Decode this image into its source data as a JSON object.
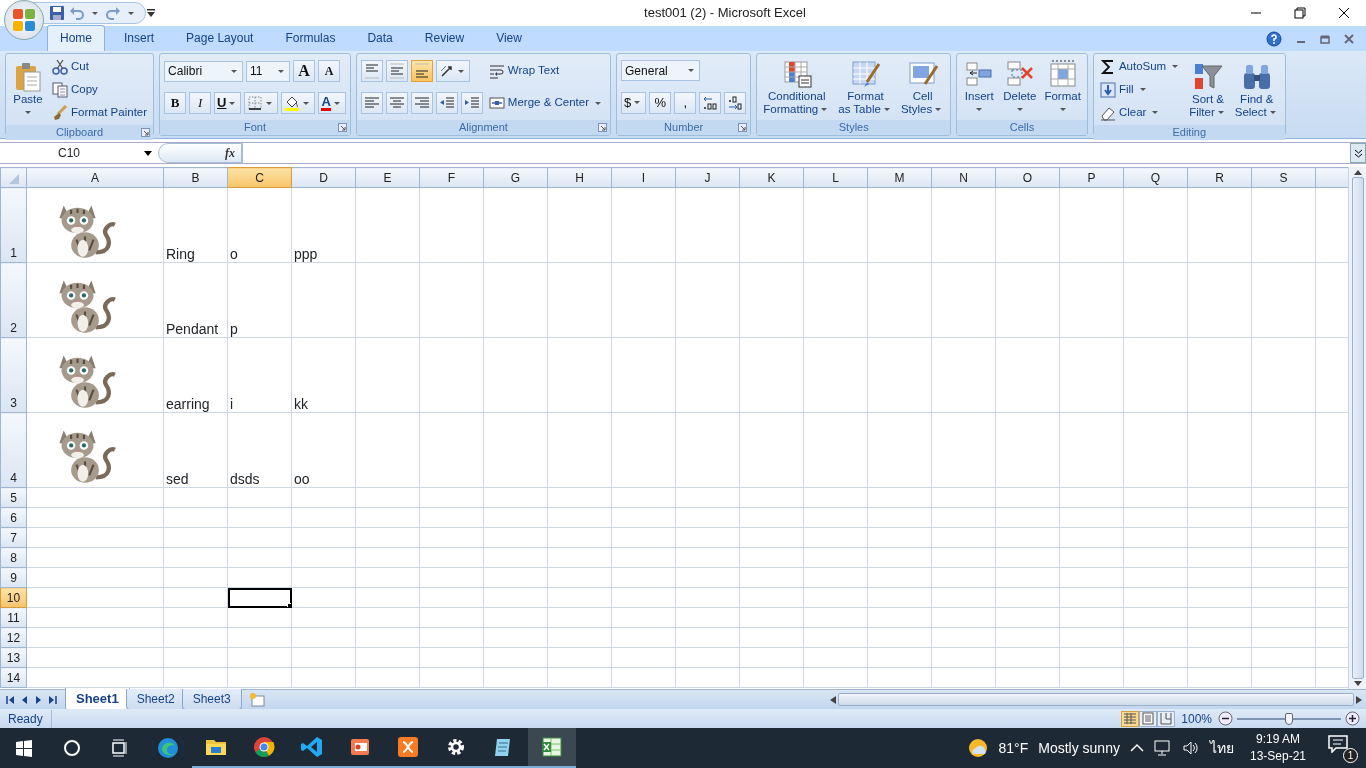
{
  "window": {
    "title": "test001 (2) - Microsoft Excel"
  },
  "tabs": [
    {
      "label": "Home",
      "selected": true
    },
    {
      "label": "Insert",
      "selected": false
    },
    {
      "label": "Page Layout",
      "selected": false
    },
    {
      "label": "Formulas",
      "selected": false
    },
    {
      "label": "Data",
      "selected": false
    },
    {
      "label": "Review",
      "selected": false
    },
    {
      "label": "View",
      "selected": false
    }
  ],
  "ribbon": [
    {
      "label": "Clipboard",
      "launcher": true,
      "columns": [
        [
          {
            "kind": "large",
            "lines": [
              "Paste"
            ],
            "menu": true
          }
        ],
        [
          {
            "kind": "small",
            "label": "Cut"
          },
          {
            "kind": "small",
            "label": "Copy"
          },
          {
            "kind": "small",
            "label": "Format Painter"
          }
        ]
      ]
    },
    {
      "label": "Font",
      "launcher": true,
      "columns": [
        [
          {
            "kind": "row",
            "items": [
              {
                "kind": "combo",
                "value": "Calibri"
              },
              {
                "kind": "combo",
                "value": "11"
              },
              {
                "kind": "tool",
                "glyph": "A",
                "on": false
              },
              {
                "kind": "tool",
                "glyph": "A",
                "on": false
              }
            ]
          },
          {
            "kind": "row",
            "items": [
              {
                "kind": "tool",
                "glyph": "B",
                "on": false
              },
              {
                "kind": "tool",
                "glyph": "I",
                "on": false
              },
              {
                "kind": "tool",
                "glyph": "U",
                "on": false,
                "menu": true
              },
              {
                "kind": "tool",
                "on": false,
                "menu": true
              },
              {
                "kind": "tool",
                "on": false,
                "menu": true
              },
              {
                "kind": "tool",
                "glyph": "A",
                "on": false,
                "menu": true
              }
            ]
          }
        ]
      ]
    },
    {
      "label": "Alignment",
      "launcher": true,
      "columns": [
        [
          {
            "kind": "row",
            "items": [
              {
                "kind": "tool",
                "on": false
              },
              {
                "kind": "tool",
                "on": false
              },
              {
                "kind": "tool",
                "on": true
              },
              {
                "kind": "tool",
                "on": false,
                "menu": true
              }
            ]
          },
          {
            "kind": "row",
            "items": [
              {
                "kind": "tool",
                "on": false
              },
              {
                "kind": "tool",
                "on": false
              },
              {
                "kind": "tool",
                "on": false
              },
              {
                "kind": "tool",
                "on": false
              },
              {
                "kind": "tool",
                "on": false
              }
            ]
          }
        ],
        [
          {
            "kind": "small",
            "label": "Wrap Text"
          },
          {
            "kind": "small",
            "label": "Merge & Center",
            "menu": true
          }
        ]
      ]
    },
    {
      "label": "Number",
      "launcher": true,
      "columns": [
        [
          {
            "kind": "row",
            "items": [
              {
                "kind": "combo",
                "value": "General"
              }
            ]
          },
          {
            "kind": "row",
            "items": [
              {
                "kind": "tool",
                "glyph": "$",
                "on": false,
                "menu": true
              },
              {
                "kind": "tool",
                "glyph": "%",
                "on": false
              },
              {
                "kind": "tool",
                "glyph": ",",
                "on": false
              },
              {
                "kind": "tool",
                "on": false
              },
              {
                "kind": "tool",
                "on": false
              }
            ]
          }
        ]
      ]
    },
    {
      "label": "Styles",
      "columns": [
        [
          {
            "kind": "large",
            "lines": [
              "Conditional",
              "Formatting"
            ],
            "menu": true
          }
        ],
        [
          {
            "kind": "large",
            "lines": [
              "Format",
              "as Table"
            ],
            "menu": true
          }
        ],
        [
          {
            "kind": "large",
            "lines": [
              "Cell",
              "Styles"
            ],
            "menu": true
          }
        ]
      ]
    },
    {
      "label": "Cells",
      "columns": [
        [
          {
            "kind": "large",
            "lines": [
              "Insert"
            ],
            "menu": true
          }
        ],
        [
          {
            "kind": "large",
            "lines": [
              "Delete"
            ],
            "menu": true
          }
        ],
        [
          {
            "kind": "large",
            "lines": [
              "Format"
            ],
            "menu": true
          }
        ]
      ]
    },
    {
      "label": "Editing",
      "columns": [
        [
          {
            "kind": "small",
            "label": "AutoSum",
            "menu": true
          },
          {
            "kind": "small",
            "label": "Fill",
            "menu": true
          },
          {
            "kind": "small",
            "label": "Clear",
            "menu": true
          }
        ],
        [
          {
            "kind": "large",
            "lines": [
              "Sort &",
              "Filter"
            ],
            "menu": true
          }
        ],
        [
          {
            "kind": "large",
            "lines": [
              "Find &",
              "Select"
            ],
            "menu": true
          }
        ]
      ]
    }
  ],
  "formula_bar": {
    "name_box": "C10",
    "fx": "fx"
  },
  "columns": [
    {
      "label": "A",
      "selected": false
    },
    {
      "label": "B",
      "selected": false
    },
    {
      "label": "C",
      "selected": true
    },
    {
      "label": "D",
      "selected": false
    },
    {
      "label": "E",
      "selected": false
    },
    {
      "label": "F",
      "selected": false
    },
    {
      "label": "G",
      "selected": false
    },
    {
      "label": "H",
      "selected": false
    },
    {
      "label": "I",
      "selected": false
    },
    {
      "label": "J",
      "selected": false
    },
    {
      "label": "K",
      "selected": false
    },
    {
      "label": "L",
      "selected": false
    },
    {
      "label": "M",
      "selected": false
    },
    {
      "label": "N",
      "selected": false
    },
    {
      "label": "O",
      "selected": false
    },
    {
      "label": "P",
      "selected": false
    },
    {
      "label": "Q",
      "selected": false
    },
    {
      "label": "R",
      "selected": false
    },
    {
      "label": "S",
      "selected": false
    }
  ],
  "rows": [
    {
      "number": "1",
      "selected": false,
      "picture": true,
      "cells": [
        null,
        "Ring",
        "o",
        "ppp"
      ]
    },
    {
      "number": "2",
      "selected": false,
      "picture": true,
      "cells": [
        null,
        "Pendant",
        "p"
      ]
    },
    {
      "number": "3",
      "selected": false,
      "picture": true,
      "cells": [
        null,
        "earring",
        "i",
        "kk"
      ]
    },
    {
      "number": "4",
      "selected": false,
      "picture": true,
      "cells": [
        null,
        "sed",
        "dsds",
        "oo"
      ]
    },
    {
      "number": "5",
      "selected": false
    },
    {
      "number": "6",
      "selected": false
    },
    {
      "number": "7",
      "selected": false
    },
    {
      "number": "8",
      "selected": false
    },
    {
      "number": "9",
      "selected": false
    },
    {
      "number": "10",
      "selected": true
    },
    {
      "number": "11",
      "selected": false
    },
    {
      "number": "12",
      "selected": false
    },
    {
      "number": "13",
      "selected": false
    },
    {
      "number": "14",
      "selected": false
    }
  ],
  "sheet_tabs": [
    {
      "label": "Sheet1",
      "selected": true
    },
    {
      "label": "Sheet2",
      "selected": false
    },
    {
      "label": "Sheet3",
      "selected": false
    }
  ],
  "status_bar": {
    "text": "Ready",
    "views": [
      {
        "selected": true
      },
      {
        "selected": false
      },
      {
        "selected": false
      }
    ],
    "zoom": "100%",
    "zoom_slider": {
      "level": 0.5
    }
  },
  "taskbar": {
    "apps": [
      {
        "running": false,
        "selected": false
      },
      {
        "running": true,
        "selected": false
      },
      {
        "running": true,
        "selected": false
      },
      {
        "running": true,
        "selected": false
      },
      {
        "running": true,
        "selected": false
      },
      {
        "running": true,
        "selected": false
      },
      {
        "running": true,
        "selected": false
      },
      {
        "running": true,
        "selected": false
      },
      {
        "running": true,
        "selected": true
      }
    ],
    "weather": {
      "temperature": "81°F",
      "condition": "Mostly sunny"
    },
    "language": "ไทย",
    "time": "9:19 AM",
    "date": "13-Sep-21",
    "notifications": "1"
  }
}
